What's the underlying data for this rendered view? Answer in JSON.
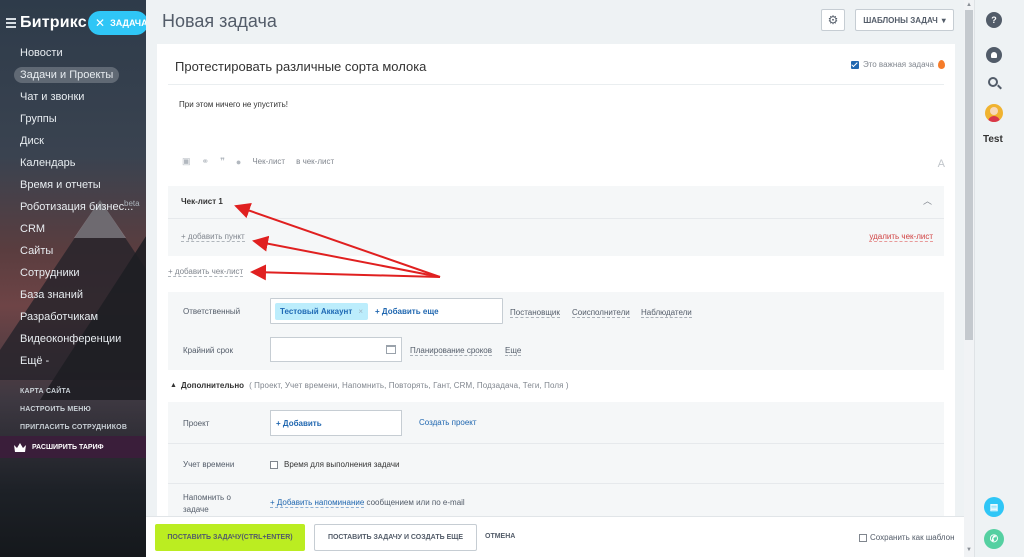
{
  "sidebar": {
    "logo": "Битрикс",
    "task_pill": "ЗАДАЧА",
    "items": [
      {
        "label": "Новости"
      },
      {
        "label": "Задачи и Проекты"
      },
      {
        "label": "Чат и звонки"
      },
      {
        "label": "Группы"
      },
      {
        "label": "Диск"
      },
      {
        "label": "Календарь"
      },
      {
        "label": "Время и отчеты"
      },
      {
        "label": "Роботизация бизнес...",
        "badge": "beta"
      },
      {
        "label": "CRM"
      },
      {
        "label": "Сайты"
      },
      {
        "label": "Сотрудники"
      },
      {
        "label": "База знаний"
      },
      {
        "label": "Разработчикам"
      },
      {
        "label": "Видеоконференции"
      },
      {
        "label": "Ещё -"
      }
    ],
    "links": [
      "КАРТА САЙТА",
      "НАСТРОИТЬ МЕНЮ",
      "ПРИГЛАСИТЬ СОТРУДНИКОВ"
    ],
    "upgrade": "РАСШИРИТЬ ТАРИФ"
  },
  "header": {
    "title": "Новая задача",
    "templates_button": "ШАБЛОНЫ ЗАДАЧ"
  },
  "task": {
    "title": "Протестировать различные сорта молока",
    "important_label": "Это важная задача",
    "description": "При этом ничего не упустить!",
    "toolbar": {
      "checklist": "Чек-лист",
      "to_checklist": "в чек-лист",
      "font": "A"
    }
  },
  "checklist": {
    "title": "Чек-лист 1",
    "add_item": "+ добавить пункт",
    "delete": "удалить чек-лист",
    "add_checklist": "+ добавить чек-лист"
  },
  "fields": {
    "responsible_label": "Ответственный",
    "responsible_chip": "Тестовый Аккаунт",
    "add_more": "+ Добавить еще",
    "role_links": [
      "Постановщик",
      "Соисполнители",
      "Наблюдатели"
    ],
    "deadline_label": "Крайний срок",
    "planning_link": "Планирование сроков",
    "more_link": "Еще"
  },
  "extra": {
    "header": "Дополнительно",
    "options": "( Проект,  Учет времени,  Напомнить,  Повторять,  Гант,  CRM,  Подзадача,  Теги,  Поля )",
    "project_label": "Проект",
    "project_add": "+ Добавить",
    "create_project": "Создать проект",
    "time_label": "Учет времени",
    "time_checkbox": "Время для выполнения задачи",
    "remind_label_1": "Напомнить о",
    "remind_label_2": "задаче",
    "remind_link": "+ Добавить напоминание",
    "remind_rest": " сообщением или по e-mail"
  },
  "footer": {
    "submit": "ПОСТАВИТЬ ЗАДАЧУ(CTRL+ENTER)",
    "submit_create": "ПОСТАВИТЬ ЗАДАЧУ И СОЗДАТЬ ЕЩЕ",
    "cancel": "ОТМЕНА",
    "save_template": "Сохранить как шаблон"
  },
  "right_panel": {
    "user_name": "Test"
  },
  "colors": {
    "accent": "#2fc6f6",
    "submit": "#bbed21",
    "arrow": "#e02020",
    "link": "#2067b0"
  }
}
